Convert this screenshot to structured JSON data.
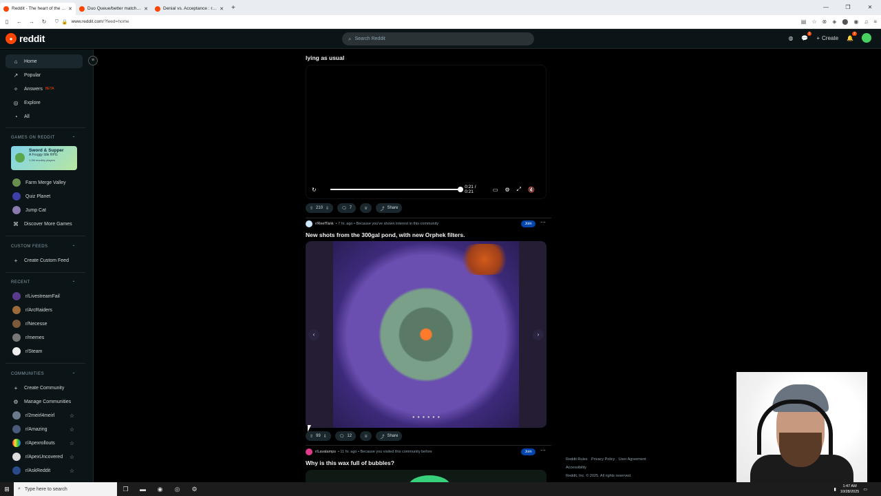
{
  "browser": {
    "tabs": [
      {
        "label": "Reddit - The heart of the intern",
        "active": true
      },
      {
        "label": "Duo Queue/better matchmakin",
        "active": false
      },
      {
        "label": "Denial vs. Acceptance : r/memes",
        "active": false
      }
    ],
    "url_host": "www.reddit.com",
    "url_path": "/?feed=home"
  },
  "header": {
    "logo": "reddit",
    "search_placeholder": "Search Reddit",
    "create_label": "Create",
    "chat_badge": "1",
    "notif_badge": "2"
  },
  "sidebar": {
    "nav": [
      {
        "label": "Home",
        "icon": "home-icon",
        "glyph": "⌂"
      },
      {
        "label": "Popular",
        "icon": "popular-icon",
        "glyph": "↗"
      },
      {
        "label": "Answers",
        "icon": "answers-icon",
        "glyph": "✧",
        "badge": "BETA"
      },
      {
        "label": "Explore",
        "icon": "explore-icon",
        "glyph": "◎"
      },
      {
        "label": "All",
        "icon": "all-icon",
        "glyph": "◔"
      }
    ],
    "games_head": "GAMES ON REDDIT",
    "promo": {
      "title": "Sword & Supper",
      "subtitle": "A Froggy Idle RPG",
      "players": "1.2M monthly players"
    },
    "games": [
      "Farm Merge Valley",
      "Quiz Planet",
      "Jump Cat",
      "Discover More Games"
    ],
    "custom_head": "CUSTOM FEEDS",
    "create_feed": "Create Custom Feed",
    "recent_head": "RECENT",
    "recent": [
      "r/LivestreamFail",
      "r/ArcRaiders",
      "r/Necesse",
      "r/memes",
      "r/Steam"
    ],
    "communities_head": "COMMUNITIES",
    "create_community": "Create Community",
    "manage_communities": "Manage Communities",
    "communities": [
      "r/2meirl4meirl",
      "r/Amazing",
      "r/Apexrollouts",
      "r/ApexUncovered",
      "r/AskReddit"
    ]
  },
  "posts": [
    {
      "title": "lying as usual",
      "video_time": "0:21 / 0:21",
      "video_progress": 1.0,
      "votes": "210",
      "comments": "7",
      "share": "Share"
    },
    {
      "sub": "r/ReefTank",
      "meta": "• 7 hr. ago • Because you've shown interest in this community",
      "join": "Join",
      "title": "New shots from the 300gal pond, with new Orphek filters.",
      "votes": "99",
      "comments": "12",
      "share": "Share"
    },
    {
      "sub": "r/Lavalamps",
      "meta": "• 11 hr. ago • Because you visited this community before",
      "join": "Join",
      "title": "Why is this wax full of bubbles?"
    }
  ],
  "footer": {
    "links": [
      "Reddit Rules",
      "Privacy Policy",
      "User Agreement"
    ],
    "accessibility": "Accessibility",
    "copyright": "Reddit, Inc. © 2025. All rights reserved."
  },
  "taskbar": {
    "search_placeholder": "Type here to search",
    "time": "1:47 AM",
    "date": "10/28/2025"
  },
  "colors": {
    "brand": "#ff4500",
    "join": "#0045ac",
    "bg": "#0b1416"
  }
}
